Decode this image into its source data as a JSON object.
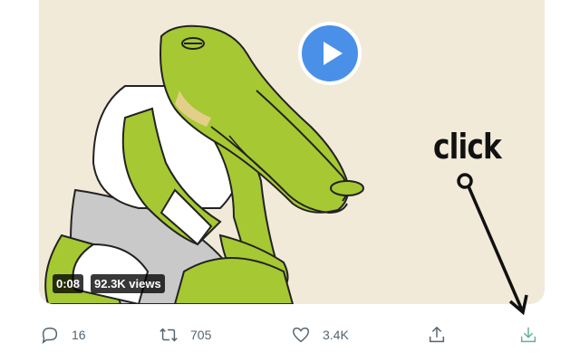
{
  "video": {
    "duration": "0:08",
    "views": "92.3K views"
  },
  "annotation": {
    "text": "click"
  },
  "actions": {
    "reply_count": "16",
    "retweet_count": "705",
    "like_count": "3.4K"
  },
  "colors": {
    "background": "#f2ead8",
    "play_button": "#4a90e8",
    "download_icon": "#5fb58d",
    "action_icon": "#536471"
  },
  "icons": [
    "play-icon",
    "reply-icon",
    "retweet-icon",
    "like-icon",
    "share-icon",
    "download-icon"
  ]
}
